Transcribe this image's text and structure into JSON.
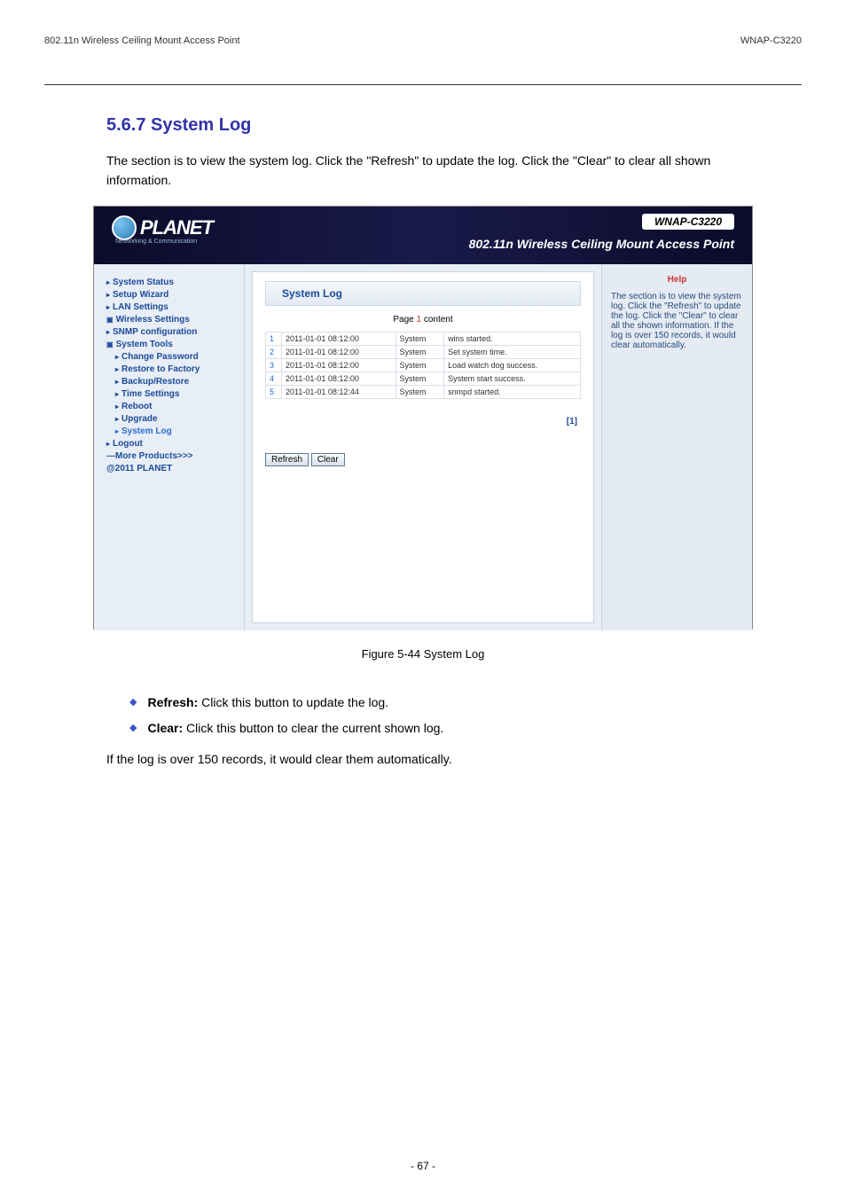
{
  "doc_header": {
    "left": "802.11n Wireless Ceiling Mount Access Point",
    "right": "WNAP-C3220"
  },
  "section": {
    "title": "5.6.7 System Log",
    "desc": "The section is to view the system log. Click the \"Refresh\" to update the log. Click the \"Clear\" to clear all shown information."
  },
  "app": {
    "logo_brand": "PLANET",
    "logo_tag": "Networking & Communication",
    "model": "WNAP-C3220",
    "model_sub": "802.11n Wireless Ceiling Mount Access Point"
  },
  "nav": {
    "items": [
      {
        "label": "System Status",
        "cls": "triangle"
      },
      {
        "label": "Setup Wizard",
        "cls": "triangle"
      },
      {
        "label": "LAN Settings",
        "cls": "triangle"
      },
      {
        "label": "Wireless Settings",
        "cls": "box"
      },
      {
        "label": "SNMP configuration",
        "cls": "triangle"
      },
      {
        "label": "System Tools",
        "cls": "box"
      }
    ],
    "sub": [
      {
        "label": "Change Password"
      },
      {
        "label": "Restore to Factory"
      },
      {
        "label": "Backup/Restore"
      },
      {
        "label": "Time Settings"
      },
      {
        "label": "Reboot"
      },
      {
        "label": "Upgrade"
      },
      {
        "label": "System Log",
        "active": true
      }
    ],
    "logout": "Logout",
    "more": "---More Products>>>",
    "copy": "@2011 PLANET"
  },
  "panel": {
    "title": "System Log",
    "page_prefix": "Page ",
    "page_num": "1",
    "page_suffix": " content",
    "rows": [
      {
        "n": "1",
        "time": "2011-01-01 08:12:00",
        "src": "System",
        "msg": "wins started."
      },
      {
        "n": "2",
        "time": "2011-01-01 08:12:00",
        "src": "System",
        "msg": "Set system time."
      },
      {
        "n": "3",
        "time": "2011-01-01 08:12:00",
        "src": "System",
        "msg": "Load watch dog success."
      },
      {
        "n": "4",
        "time": "2011-01-01 08:12:00",
        "src": "System",
        "msg": "System start success."
      },
      {
        "n": "5",
        "time": "2011-01-01 08:12:44",
        "src": "System",
        "msg": "snmpd started."
      }
    ],
    "pager": "[1]",
    "btn_refresh": "Refresh",
    "btn_clear": "Clear"
  },
  "help": {
    "title": "Help",
    "text": "The section is to view the system log. Click the \"Refresh\" to update the log. Click the \"Clear\" to clear all the shown information. If the log is over 150 records, it would clear automatically."
  },
  "figure_caption": "Figure 5-44 System Log",
  "bullets": {
    "refresh_label": "Refresh: ",
    "refresh_text": "Click this button to update the log.",
    "clear_label": "Clear: ",
    "clear_text": "Click this button to clear the current shown log.",
    "note": "If the log is over 150 records, it would clear them automatically."
  },
  "page_number": "- 67 -"
}
